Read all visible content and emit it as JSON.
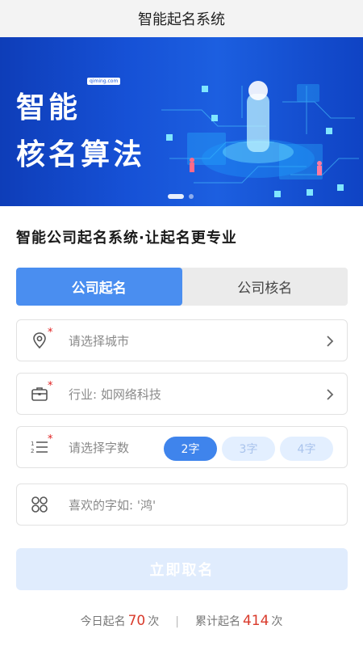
{
  "app": {
    "title": "智能起名系统"
  },
  "banner": {
    "line1": "智能",
    "line2": "核名算法",
    "tag": "qiming.com",
    "slides": 2,
    "active_slide": 1
  },
  "headline": "智能公司起名系统·让起名更专业",
  "tabs": [
    {
      "label": "公司起名",
      "active": true
    },
    {
      "label": "公司核名",
      "active": false
    }
  ],
  "form": {
    "city": {
      "placeholder": "请选择城市",
      "required": true,
      "icon": "location-pin-icon"
    },
    "industry": {
      "placeholder": "行业: 如网络科技",
      "required": true,
      "icon": "briefcase-icon"
    },
    "char_count": {
      "label": "请选择字数",
      "required": true,
      "icon": "numbered-list-icon",
      "options": [
        "2字",
        "3字",
        "4字"
      ],
      "selected": "2字"
    },
    "favorite_chars": {
      "placeholder": "喜欢的字如: '鸿'",
      "required": false,
      "icon": "grid-icon"
    }
  },
  "submit_label": "立即取名",
  "stats": {
    "today_label": "今日起名",
    "today_count": "70",
    "today_unit": "次",
    "separator": "|",
    "total_label": "累计起名",
    "total_count": "414",
    "total_unit": "次"
  },
  "colors": {
    "primary": "#4a8ef0",
    "accent_red": "#d93a2b",
    "banner_blue": "#1651d6"
  }
}
